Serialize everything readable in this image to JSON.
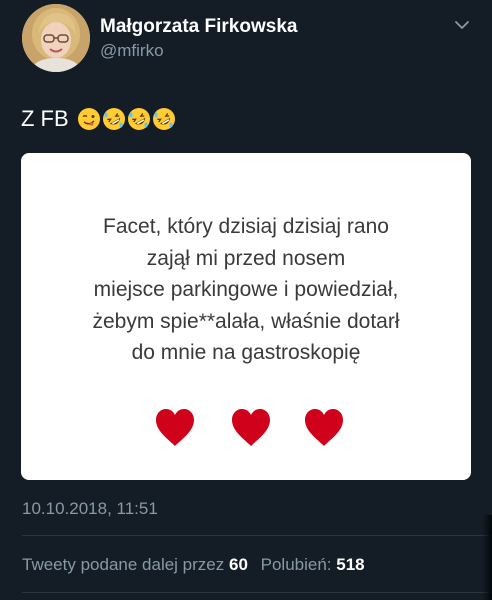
{
  "author": {
    "display_name": "Małgorzata Firkowska",
    "handle": "@mfirko",
    "avatar_icon": "profile-photo"
  },
  "menu_icon": "chevron-down-icon",
  "tweet": {
    "text": "Z FB",
    "emojis": [
      "winking-face-with-tongue",
      "rolling-on-the-floor-laughing",
      "rolling-on-the-floor-laughing",
      "rolling-on-the-floor-laughing"
    ]
  },
  "card": {
    "lines": [
      "Facet, który dzisiaj dzisiaj rano",
      "zajął mi przed nosem",
      "miejsce parkingowe i powiedział,",
      "żebym spie**alała, właśnie dotarł",
      "do mnie na gastroskopię"
    ],
    "hearts": [
      "red-heart",
      "red-heart",
      "red-heart"
    ],
    "heart_color": "#d0021b"
  },
  "timestamp": "10.10.2018, 11:51",
  "stats": {
    "retweets_label": "Tweety podane dalej przez",
    "retweets_count": "60",
    "likes_label": "Polubień:",
    "likes_count": "518"
  },
  "colors": {
    "background": "#141d26",
    "secondary_text": "#8899a6",
    "primary_text": "#ffffff",
    "card_background": "#ffffff"
  }
}
